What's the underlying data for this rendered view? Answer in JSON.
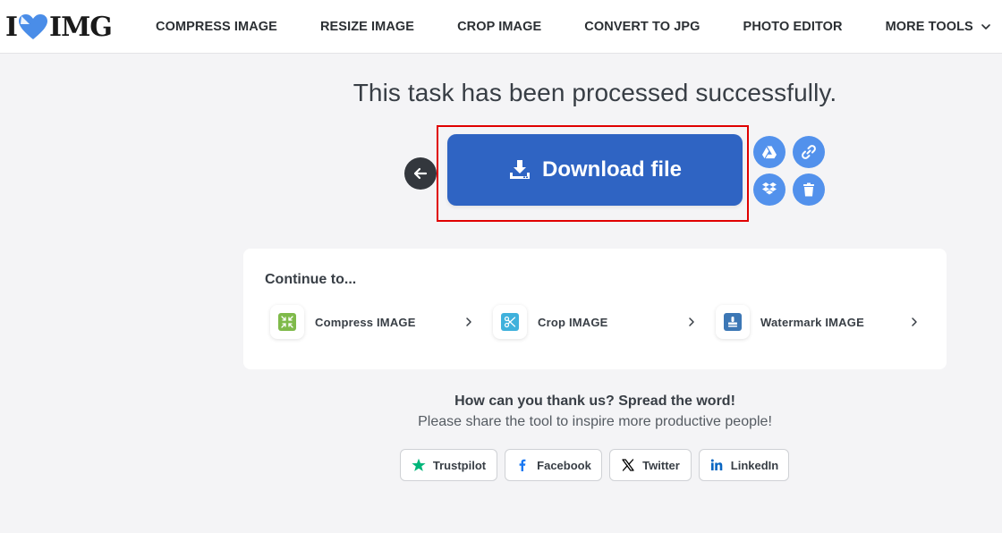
{
  "header": {
    "logo_left": "I",
    "logo_right": "IMG",
    "nav": [
      {
        "label": "COMPRESS IMAGE"
      },
      {
        "label": "RESIZE IMAGE"
      },
      {
        "label": "CROP IMAGE"
      },
      {
        "label": "CONVERT TO JPG"
      },
      {
        "label": "PHOTO EDITOR"
      },
      {
        "label": "MORE TOOLS"
      }
    ]
  },
  "main": {
    "title": "This task has been processed successfully.",
    "download_label": "Download file"
  },
  "continue": {
    "title": "Continue to...",
    "tools": [
      {
        "label": "Compress IMAGE",
        "icon": "compress-icon",
        "color": "#7fba4a"
      },
      {
        "label": "Crop IMAGE",
        "icon": "scissors-icon",
        "color": "#3fb1dc"
      },
      {
        "label": "Watermark IMAGE",
        "icon": "stamp-icon",
        "color": "#3c77b5"
      }
    ]
  },
  "share": {
    "title": "How can you thank us? Spread the word!",
    "subtitle": "Please share the tool to inspire more productive people!",
    "buttons": [
      {
        "label": "Trustpilot",
        "icon": "star-icon",
        "color": "#00b67a"
      },
      {
        "label": "Facebook",
        "icon": "facebook-icon",
        "color": "#1877f2"
      },
      {
        "label": "Twitter",
        "icon": "x-icon",
        "color": "#000000"
      },
      {
        "label": "LinkedIn",
        "icon": "linkedin-icon",
        "color": "#0a66c2"
      }
    ]
  },
  "colors": {
    "primary": "#2f64c3",
    "secondary_action": "#5291ec",
    "highlight": "#e00000"
  }
}
